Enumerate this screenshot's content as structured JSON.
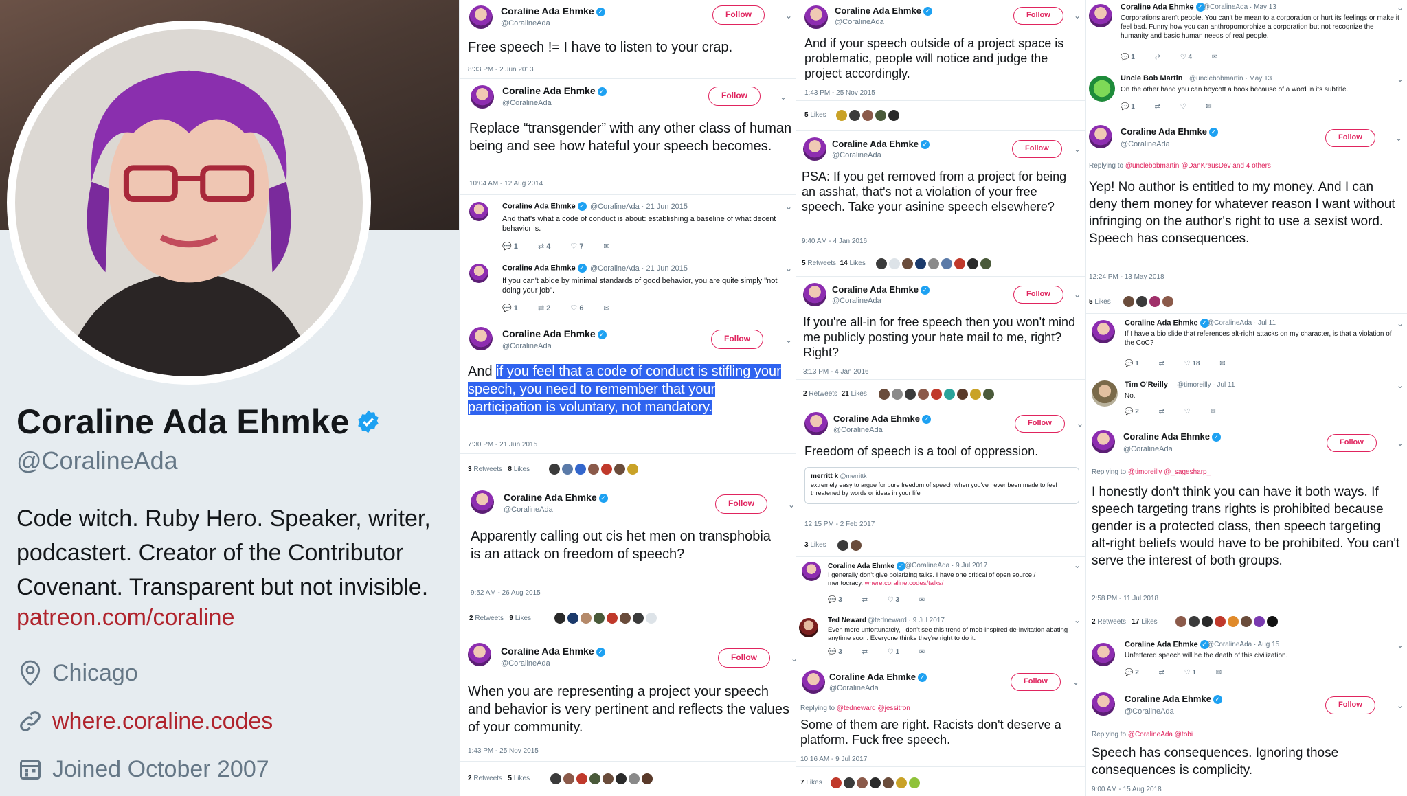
{
  "profile": {
    "name": "Coraline Ada Ehmke",
    "handle": "@CoralineAda",
    "bio": "Code witch. Ruby Hero. Speaker, writer, podcastert. Creator of the Contributor Covenant. Transparent but not invisible.",
    "bio_link": "patreon.com/coraline",
    "location": "Chicago",
    "website": "where.coraline.codes",
    "joined": "Joined October 2007"
  },
  "labels": {
    "follow": "Follow",
    "retweets": "Retweets",
    "likes": "Likes",
    "replying_to": "Replying to"
  },
  "col1": {
    "t1": {
      "name": "Coraline Ada Ehmke",
      "handle": "@CoralineAda",
      "text": "Free speech != I have to listen to your crap.",
      "time": "8:33 PM - 2 Jun 2013"
    },
    "t2": {
      "name": "Coraline Ada Ehmke",
      "handle": "@CoralineAda",
      "text": "Replace “transgender” with any other class of human being and see how hateful your speech becomes.",
      "time": "10:04 AM - 12 Aug 2014"
    },
    "t3": {
      "name": "Coraline Ada Ehmke",
      "handle": "@CoralineAda · 21 Jun 2015",
      "text": "And that's what a code of conduct is about: establishing a baseline of what decent behavior is.",
      "replies": "1",
      "retweets": "4",
      "likes": "7"
    },
    "t4": {
      "name": "Coraline Ada Ehmke",
      "handle": "@CoralineAda · 21 Jun 2015",
      "text": "If you can't abide by minimal standards of good behavior, you are quite simply \"not doing your job\".",
      "replies": "1",
      "retweets": "2",
      "likes": "6"
    },
    "t5": {
      "name": "Coraline Ada Ehmke",
      "handle": "@CoralineAda",
      "text_plain": "And ",
      "text_hl": "if you feel that a code of conduct is stifling your speech, you need to remember that your participation is voluntary, not mandatory.",
      "time": "7:30 PM - 21 Jun 2015",
      "retweets": "3",
      "likes": "8"
    },
    "t6": {
      "name": "Coraline Ada Ehmke",
      "handle": "@CoralineAda",
      "text": "Apparently calling out cis het men on transphobia is an attack on freedom of speech?",
      "time": "9:52 AM - 26 Aug 2015",
      "retweets": "2",
      "likes": "9"
    },
    "t7": {
      "name": "Coraline Ada Ehmke",
      "handle": "@CoralineAda",
      "text": "When you are representing a project your speech and behavior is very pertinent and reflects the values of your community.",
      "time": "1:43 PM - 25 Nov 2015",
      "retweets": "2",
      "likes": "5"
    }
  },
  "col2": {
    "t1": {
      "name": "Coraline Ada Ehmke",
      "handle": "@CoralineAda",
      "text": "And if your speech outside of a project space is problematic, people will notice and judge the project accordingly.",
      "time": "1:43 PM - 25 Nov 2015",
      "likes": "5"
    },
    "t2": {
      "name": "Coraline Ada Ehmke",
      "handle": "@CoralineAda",
      "text": "PSA: If you get removed from a project for being an asshat, that's not a violation of your free speech. Take your asinine speech elsewhere?",
      "time": "9:40 AM - 4 Jan 2016",
      "retweets": "5",
      "likes": "14"
    },
    "t3": {
      "name": "Coraline Ada Ehmke",
      "handle": "@CoralineAda",
      "text": "If you're all-in for free speech then you won't mind me publicly posting your hate mail to me, right? Right?",
      "time": "3:13 PM - 4 Jan 2016",
      "retweets": "2",
      "likes": "21"
    },
    "t4": {
      "name": "Coraline Ada Ehmke",
      "handle": "@CoralineAda",
      "text": "Freedom of speech is a tool of oppression.",
      "quote_name": "merritt k",
      "quote_handle": "@merrittk",
      "quote_text": "extremely easy to argue for pure freedom of speech when you've never been made to feel threatened by words or ideas in your life",
      "time": "12:15 PM - 2 Feb 2017",
      "likes": "3"
    },
    "t5": {
      "name": "Coraline Ada Ehmke",
      "handle": "@CoralineAda · 9 Jul 2017",
      "text": "I generally don't give polarizing talks. I have one critical of open source / meritocracy.",
      "link": "where.coraline.codes/talks/",
      "replies": "3",
      "likes": "3"
    },
    "t6": {
      "name": "Ted Neward",
      "handle": "@tedneward · 9 Jul 2017",
      "text": "Even more unfortunately, I don't see this trend of mob-inspired de-invitation abating anytime soon. Everyone thinks they're right to do it.",
      "replies": "3",
      "likes": "1"
    },
    "t7": {
      "name": "Coraline Ada Ehmke",
      "handle": "@CoralineAda",
      "replying": "@tedneward @jessitron",
      "text": "Some of them are right. Racists don't deserve a platform. Fuck free speech.",
      "time": "10:16 AM - 9 Jul 2017",
      "likes": "7"
    }
  },
  "col3": {
    "t1": {
      "name": "Coraline Ada Ehmke",
      "handle": "@CoralineAda · May 13",
      "text": "Corporations aren't people. You can't be mean to a corporation or hurt its feelings or make it feel bad. Funny how you can anthropomorphize a corporation but not recognize the humanity and basic human needs of real people.",
      "replies": "1",
      "likes": "4"
    },
    "t2": {
      "name": "Uncle Bob Martin",
      "handle": "@unclebobmartin · May 13",
      "text": "On the other hand you can boycott a book because of a word in its subtitle.",
      "replies": "1"
    },
    "t3": {
      "name": "Coraline Ada Ehmke",
      "handle": "@CoralineAda",
      "replying": "@unclebobmartin @DanKrausDev and 4 others",
      "text": "Yep! No author is entitled to my money. And I can deny them money for whatever reason I want without infringing on the author's right to use a sexist word. Speech has consequences.",
      "time": "12:24 PM - 13 May 2018",
      "likes": "5"
    },
    "t4": {
      "name": "Coraline Ada Ehmke",
      "handle": "@CoralineAda · Jul 11",
      "text": "If I have a bio slide that references alt-right attacks on my character, is that a violation of the CoC?",
      "replies": "1",
      "likes": "18"
    },
    "t5": {
      "name": "Tim O'Reilly",
      "handle": "@timoreilly · Jul 11",
      "text": "No.",
      "replies": "2"
    },
    "t6": {
      "name": "Coraline Ada Ehmke",
      "handle": "@CoralineAda",
      "replying": "@timoreilly @_sagesharp_",
      "text": "I honestly don't think you can have it both ways. If speech targeting trans rights is prohibited because gender is a protected class, then speech targeting alt-right beliefs would have to be prohibited. You can't serve the interest of both groups.",
      "time": "2:58 PM - 11 Jul 2018",
      "retweets": "2",
      "likes": "17"
    },
    "t7": {
      "name": "Coraline Ada Ehmke",
      "handle": "@CoralineAda · Aug 15",
      "text": "Unfettered speech will be the death of this civilization.",
      "replies": "2",
      "likes": "1"
    },
    "t8": {
      "name": "Coraline Ada Ehmke",
      "handle": "@CoralineAda",
      "replying": "@CoralineAda @tobi",
      "text": "Speech has consequences. Ignoring those consequences is complicity.",
      "time": "9:00 AM - 15 Aug 2018"
    }
  },
  "colors": {
    "follow": "#e0245e",
    "verified": "#1da1f2",
    "highlight": "#2f63ef",
    "link_red": "#b0242d"
  },
  "icons": [
    "verified-icon",
    "location-icon",
    "link-icon",
    "calendar-icon",
    "reply-icon",
    "retweet-icon",
    "like-icon",
    "mail-icon",
    "chevron-down-icon"
  ]
}
